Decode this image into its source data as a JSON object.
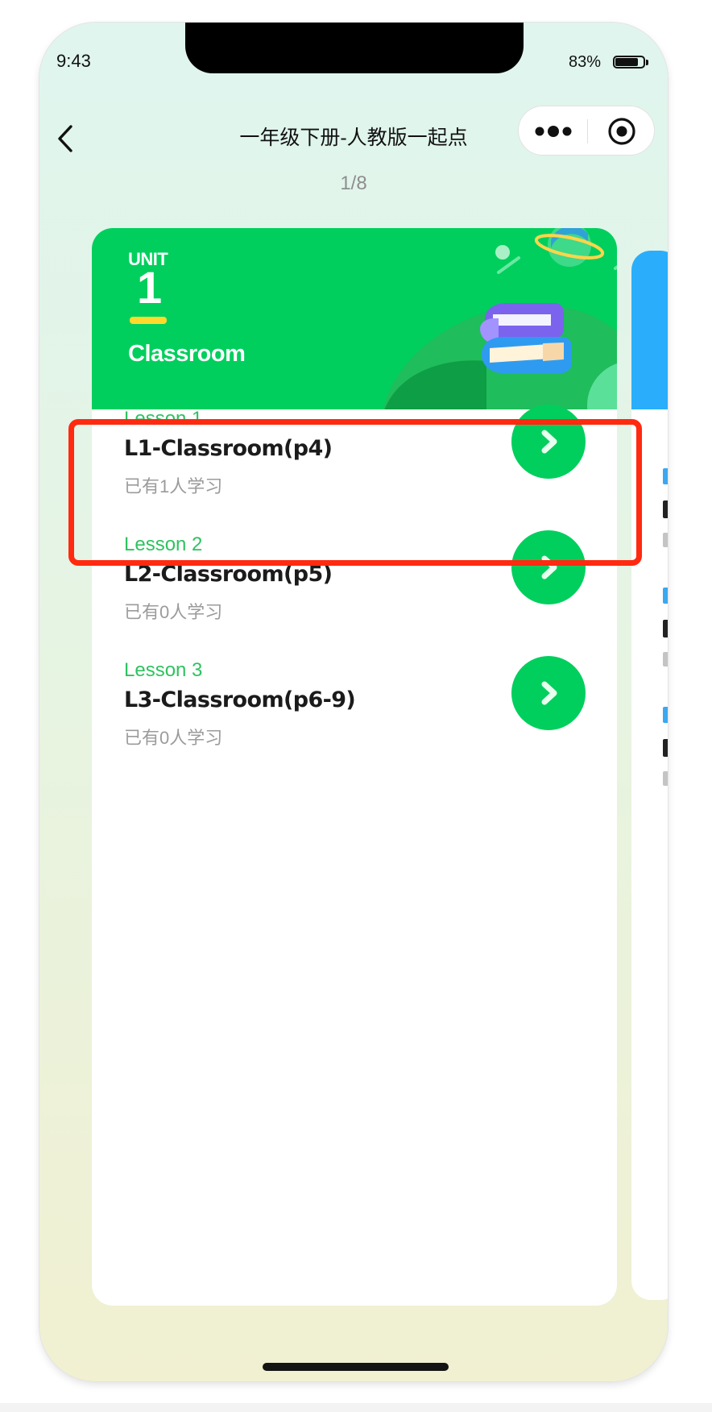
{
  "status_bar": {
    "time": "9:43",
    "battery_text": "83%",
    "battery_level": 0.83
  },
  "nav": {
    "title": "一年级下册-人教版一起点"
  },
  "pager": {
    "text": "1/8"
  },
  "unit": {
    "label": "UNIT",
    "number": "1",
    "title": "Classroom"
  },
  "lessons": [
    {
      "tag": "Lesson 1",
      "name": "L1-Classroom(p4)",
      "count": "已有1人学习"
    },
    {
      "tag": "Lesson 2",
      "name": "L2-Classroom(p5)",
      "count": "已有0人学习"
    },
    {
      "tag": "Lesson 3",
      "name": "L3-Classroom(p6-9)",
      "count": "已有0人学习"
    }
  ],
  "colors": {
    "accent_green": "#00cf5d",
    "lesson_tag_green": "#2fc260",
    "next_card_blue": "#2aaefb",
    "highlight_red": "#ff2a10",
    "unit_underline_yellow": "#ffd92b"
  },
  "icons": {
    "back": "chevron-left-icon",
    "more": "more-dots-icon",
    "record": "target-circle-icon",
    "lesson_go": "chevron-right-icon",
    "header_illustration": "books-planet-illustration"
  }
}
